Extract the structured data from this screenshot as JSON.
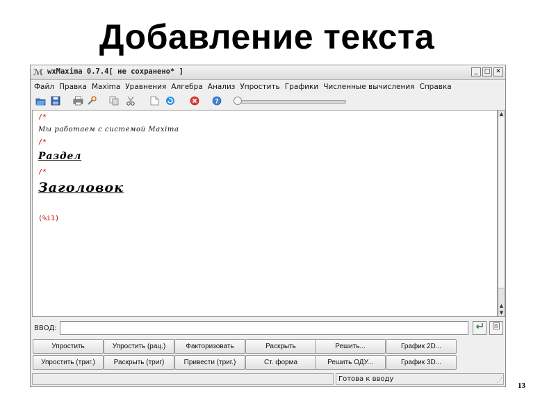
{
  "slide": {
    "title": "Добавление текста",
    "page_number": "13"
  },
  "window": {
    "title": "wxMaxima 0.7.4[ не сохранено* ]",
    "minimize": "_",
    "maximize": "□",
    "close": "✕"
  },
  "menu": [
    "Файл",
    "Правка",
    "Maxima",
    "Уравнения",
    "Алгебра",
    "Анализ",
    "Упростить",
    "Графики",
    "Численные вычисления",
    "Справка"
  ],
  "toolbar": {
    "icons": [
      "open-icon",
      "save-icon",
      "print-icon",
      "configure-icon",
      "copy-icon",
      "cut-icon",
      "select-all-icon",
      "interrupt-icon",
      "stop-icon",
      "help-icon"
    ]
  },
  "document": {
    "comment_marker_1": "/*",
    "text_cell": "Мы работаем с системой Maxima",
    "comment_marker_2": "/*",
    "section": "Раздел",
    "comment_marker_3": "/*",
    "heading": "Заголовок",
    "input_label": "(%i1)"
  },
  "input": {
    "label": "ВВОД:",
    "value": ""
  },
  "buttons": {
    "row1": [
      "Упростить",
      "Упростить (рац.)",
      "Факторизовать",
      "Раскрыть",
      "Решить...",
      "График 2D..."
    ],
    "row2": [
      "Упростить (триг.)",
      "Раскрыть (триг)",
      "Привести (триг.)",
      "Ст. форма",
      "Решить ОДУ...",
      "График 3D..."
    ]
  },
  "status": {
    "left": "",
    "right": "Готова к вводу"
  }
}
